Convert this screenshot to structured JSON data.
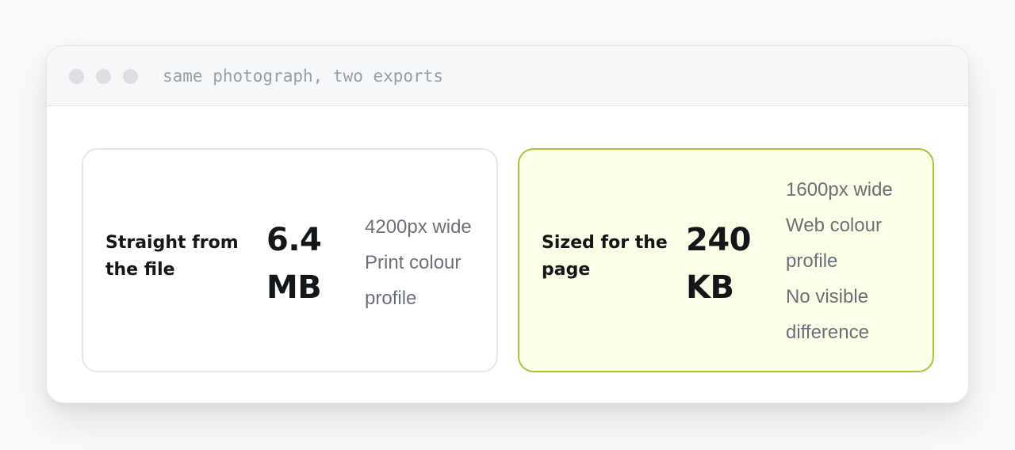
{
  "window": {
    "title": "same photograph, two exports",
    "controls": [
      "window-dot",
      "window-dot",
      "window-dot"
    ]
  },
  "cards": {
    "original": {
      "label": "Straight from the file",
      "size": "6.4 MB",
      "details": [
        "4200px wide",
        "Print colour profile"
      ]
    },
    "optimized": {
      "label": "Sized for the page",
      "size": "240 KB",
      "details": [
        "1600px wide",
        "Web colour profile",
        "No visible difference"
      ],
      "accent_color": "#a9c23a",
      "background_color": "#fbffe8"
    }
  }
}
